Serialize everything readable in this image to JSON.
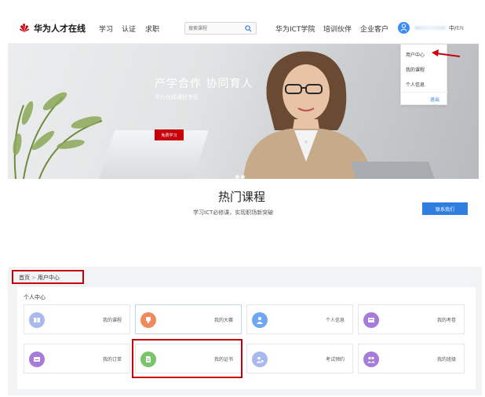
{
  "header": {
    "brand": "华为人才在线",
    "nav_left": [
      "学习",
      "认证",
      "求职"
    ],
    "search_placeholder": "搜索课程",
    "nav_right": [
      "华为ICT学院",
      "培训伙伴",
      "企业客户"
    ],
    "lang_cn": "中",
    "lang_sep": "/",
    "lang_en": "EN"
  },
  "banner": {
    "title": "产学合作 协同育人",
    "subtitle": "华为在线课程专区",
    "button": "免费学习"
  },
  "dropdown": {
    "items": [
      "用户中心",
      "我的课程",
      "个人信息"
    ],
    "logout": "退出"
  },
  "hot": {
    "title": "热门课程",
    "subtitle": "学习ICT必修课，实现职场新突破",
    "contact": "联系我们"
  },
  "breadcrumb": {
    "home": "首页",
    "sep": ">",
    "current": "用户中心"
  },
  "personal_center": {
    "title": "个人中心",
    "cards": [
      {
        "label": "我的课程",
        "icon": "course-icon",
        "color": "#a9b9ee"
      },
      {
        "label": "我的大赛",
        "icon": "trophy-icon",
        "color": "#f08a5d"
      },
      {
        "label": "个人信息",
        "icon": "person-icon",
        "color": "#6fa8f0"
      },
      {
        "label": "我的考卷",
        "icon": "exam-icon",
        "color": "#a77bd9"
      },
      {
        "label": "我的订单",
        "icon": "order-icon",
        "color": "#a77bd9"
      },
      {
        "label": "我的证书",
        "icon": "certificate-icon",
        "color": "#7cc46b"
      },
      {
        "label": "考试预约",
        "icon": "appointment-icon",
        "color": "#a9b9ee"
      },
      {
        "label": "我的班级",
        "icon": "class-icon",
        "color": "#a77bd9"
      }
    ]
  },
  "colors": {
    "brand_red": "#c7000b",
    "link_blue": "#2e7de1"
  }
}
